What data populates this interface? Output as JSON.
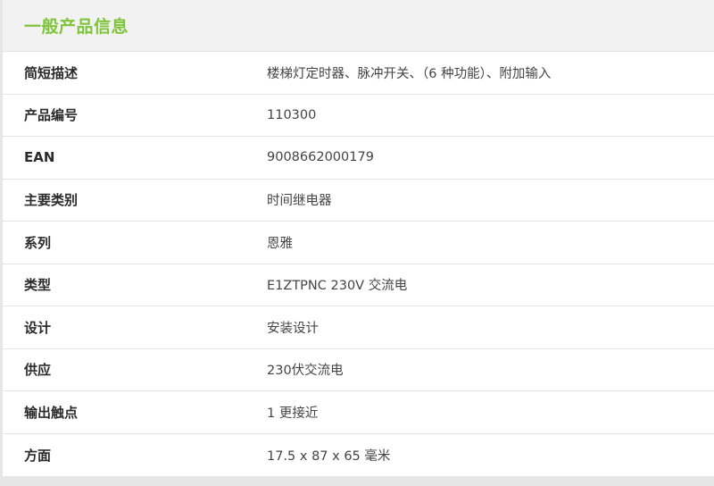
{
  "section": {
    "title": "一般产品信息"
  },
  "rows": [
    {
      "label": "简短描述",
      "value": "楼梯灯定时器、脉冲开关、（6 种功能）、附加输入"
    },
    {
      "label": "产品编号",
      "value": "110300"
    },
    {
      "label": "EAN",
      "value": "9008662000179"
    },
    {
      "label": "主要类别",
      "value": "时间继电器"
    },
    {
      "label": "系列",
      "value": "恩雅"
    },
    {
      "label": "类型",
      "value": "E1ZTPNC 230V 交流电"
    },
    {
      "label": "设计",
      "value": "安装设计"
    },
    {
      "label": "供应",
      "value": "230伏交流电"
    },
    {
      "label": "输出触点",
      "value": "1 更接近"
    },
    {
      "label": "方面",
      "value": "17.5 x 87 x 65 毫米"
    }
  ],
  "colors": {
    "title_accent": "#80c43c",
    "header_bg": "#f2f2f2",
    "page_bg": "#e6e6e6"
  }
}
